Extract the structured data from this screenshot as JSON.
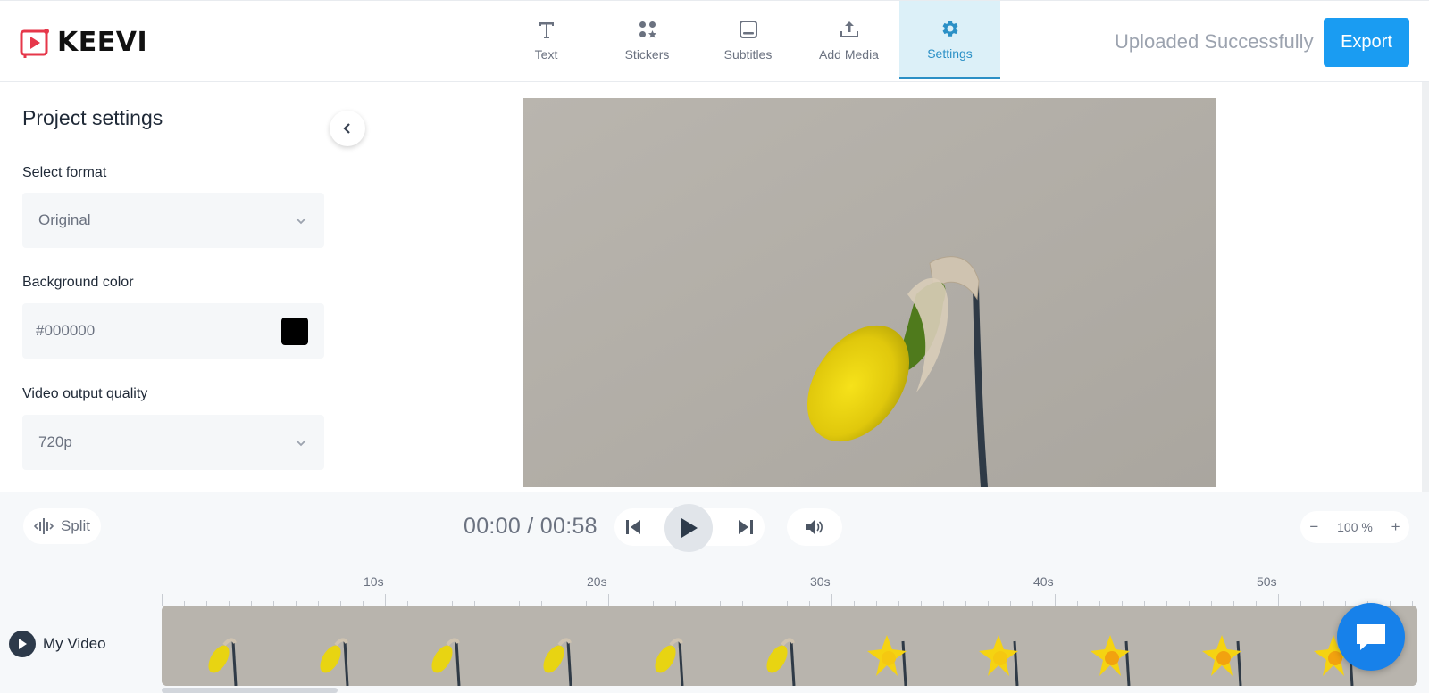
{
  "app": {
    "logo_text": "KEEVI"
  },
  "header": {
    "tabs": [
      {
        "label": "Text",
        "icon": "text-icon"
      },
      {
        "label": "Stickers",
        "icon": "stickers-icon"
      },
      {
        "label": "Subtitles",
        "icon": "subtitles-icon"
      },
      {
        "label": "Add Media",
        "icon": "upload-icon"
      },
      {
        "label": "Settings",
        "icon": "gear-icon",
        "active": true
      }
    ],
    "status": "Uploaded Successfully",
    "export_label": "Export"
  },
  "sidebar": {
    "title": "Project settings",
    "format": {
      "label": "Select format",
      "value": "Original"
    },
    "background": {
      "label": "Background color",
      "value": "#000000",
      "swatch": "#000000"
    },
    "quality": {
      "label": "Video output quality",
      "value": "720p"
    }
  },
  "controls": {
    "split_label": "Split",
    "timecode": "00:00 / 00:58",
    "zoom_label": "100 %",
    "zoom_out": "−",
    "zoom_in": "+"
  },
  "timeline": {
    "ticks": [
      "10s",
      "20s",
      "30s",
      "40s",
      "50s"
    ],
    "track_name": "My Video",
    "frame_count": 12
  },
  "colors": {
    "accent": "#1a9cf2",
    "active_tab": "#2b90c6",
    "chat": "#1781ea"
  }
}
